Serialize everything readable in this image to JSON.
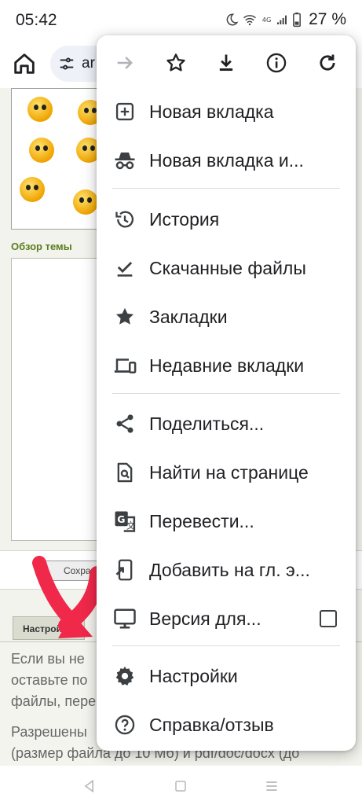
{
  "status_bar": {
    "time": "05:42",
    "battery": "27 %",
    "icons": [
      "moon-icon",
      "wifi-icon",
      "volte-icon",
      "signal-icon",
      "battery-icon"
    ]
  },
  "toolbar": {
    "home_icon": "home-icon",
    "omnibox_text": "ar",
    "site_settings_icon": "tune-icon"
  },
  "page": {
    "topic_label": "Обзор темы",
    "save_button": "Сохранить",
    "settings_tab": "Настройки",
    "info_lines": [
      "Если вы не",
      "оставьте по",
      "файлы, пере",
      "Разрешены",
      "(размер файла до 10 Мб) и pdf/doc/docx (до"
    ]
  },
  "menu": {
    "icon_row": [
      "forward-icon",
      "bookmark-star-icon",
      "download-icon",
      "info-icon",
      "refresh-icon"
    ],
    "items": [
      {
        "label": "Новая вкладка",
        "icon": "new-tab-icon"
      },
      {
        "label": "Новая вкладка и...",
        "icon": "incognito-icon"
      },
      {
        "label": "История",
        "icon": "history-icon"
      },
      {
        "label": "Скачанные файлы",
        "icon": "downloads-icon"
      },
      {
        "label": "Закладки",
        "icon": "bookmarks-icon"
      },
      {
        "label": "Недавние вкладки",
        "icon": "recent-tabs-icon"
      },
      {
        "label": "Поделиться...",
        "icon": "share-icon"
      },
      {
        "label": "Найти на странице",
        "icon": "find-in-page-icon"
      },
      {
        "label": "Перевести...",
        "icon": "translate-icon"
      },
      {
        "label": "Добавить на гл. э...",
        "icon": "add-to-home-icon"
      },
      {
        "label": "Версия для...",
        "icon": "desktop-icon",
        "checkbox": false
      },
      {
        "label": "Настройки",
        "icon": "settings-icon"
      },
      {
        "label": "Справка/отзыв",
        "icon": "help-icon"
      }
    ]
  },
  "colors": {
    "menu_bg": "#ffffff",
    "icon": "#3c4043",
    "divider": "#dadce0",
    "annotation_arrow": "#f0284a",
    "page_bg": "#f3f3ee"
  },
  "navbar": [
    "back-icon",
    "home-square-icon",
    "recents-icon"
  ]
}
